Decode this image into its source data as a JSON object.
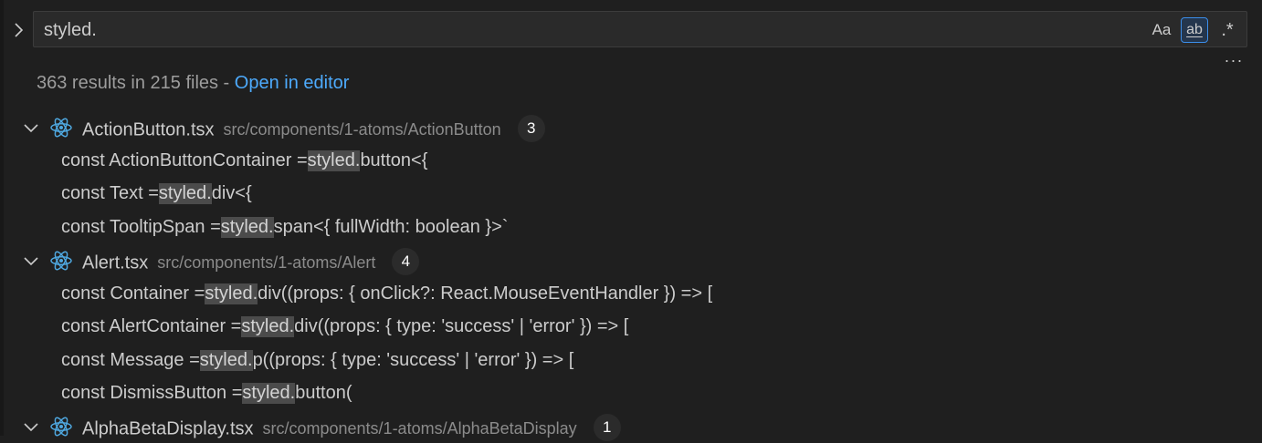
{
  "search": {
    "query": "styled.",
    "options": {
      "match_case_label": "Aa",
      "whole_word_label": "ab",
      "regex_label": ".*"
    },
    "more_label": "···"
  },
  "summary": {
    "text": "363 results in 215 files - ",
    "open_in_editor": "Open in editor"
  },
  "colors": {
    "react_icon": "#4fa8e0",
    "highlight_bg": "#4b4b4b",
    "link": "#4daafc"
  },
  "files": [
    {
      "name": "ActionButton.tsx",
      "path": "src/components/1-atoms/ActionButton",
      "count": "3",
      "icon": "react-icon",
      "matches": [
        {
          "before": "const ActionButtonContainer = ",
          "match": "styled.",
          "after": "button<{"
        },
        {
          "before": "const Text = ",
          "match": "styled.",
          "after": "div<{"
        },
        {
          "before": "const TooltipSpan = ",
          "match": "styled.",
          "after": "span<{ fullWidth: boolean }>`"
        }
      ]
    },
    {
      "name": "Alert.tsx",
      "path": "src/components/1-atoms/Alert",
      "count": "4",
      "icon": "react-icon",
      "matches": [
        {
          "before": "const Container = ",
          "match": "styled.",
          "after": "div((props: { onClick?: React.MouseEventHandler }) => ["
        },
        {
          "before": "const AlertContainer = ",
          "match": "styled.",
          "after": "div((props: { type: 'success' | 'error' }) => ["
        },
        {
          "before": "const Message = ",
          "match": "styled.",
          "after": "p((props: { type: 'success' | 'error' }) => ["
        },
        {
          "before": "const DismissButton = ",
          "match": "styled.",
          "after": "button("
        }
      ]
    },
    {
      "name": "AlphaBetaDisplay.tsx",
      "path": "src/components/1-atoms/AlphaBetaDisplay",
      "count": "1",
      "icon": "react-icon",
      "matches": []
    }
  ]
}
